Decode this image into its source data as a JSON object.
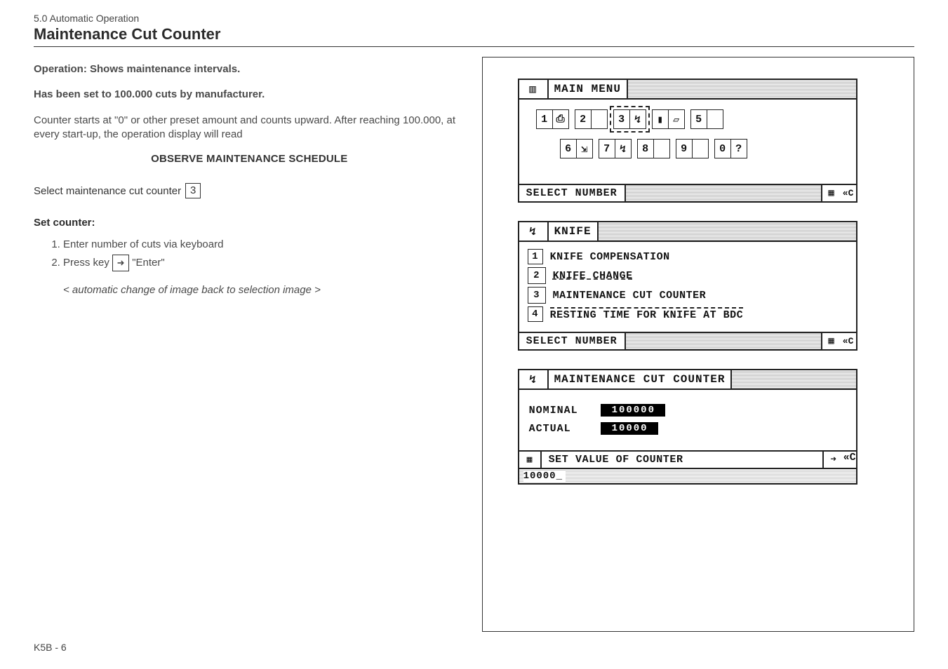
{
  "breadcrumb": "5.0 Automatic Operation",
  "title": "Maintenance Cut Counter",
  "left": {
    "op_label": "Operation:  Shows maintenance intervals.",
    "preset_line": "Has been set to 100.000 cuts by manufacturer.",
    "para1": "Counter starts at \"0\" or other preset amount and counts upward. After reaching 100.000, at every start-up, the operation display will read",
    "schedule": "OBSERVE MAINTENANCE SCHEDULE",
    "select_label": "Select maintenance cut counter",
    "select_key": "3",
    "set_counter_head": "Set counter:",
    "step1": "Enter number of cuts via keyboard",
    "step2a": "Press key ",
    "enter_glyph": "➜",
    "step2b": " \"Enter\"",
    "note": "< automatic change of image back to selection image >"
  },
  "lcd_main": {
    "icon": "▥",
    "title": "MAIN MENU",
    "row1": [
      {
        "n": "1",
        "sym": "⎙"
      },
      {
        "n": "2",
        "sym": " ",
        "blank": true
      },
      {
        "n": "3",
        "sym": "↯",
        "hl": true
      },
      {
        "n": "▮",
        "sym": "▱"
      },
      {
        "n": "5",
        "sym": " ",
        "blank": true
      }
    ],
    "row2": [
      {
        "n": "6",
        "sym": "⇲"
      },
      {
        "n": "7",
        "sym": "↯"
      },
      {
        "n": "8",
        "sym": " ",
        "blank": true
      },
      {
        "n": "9",
        "sym": " ",
        "blank": true
      },
      {
        "n": "0",
        "sym": "?"
      }
    ],
    "foot_label": "SELECT NUMBER",
    "foot_icon": "▦",
    "foot_c": "«C"
  },
  "lcd_knife": {
    "icon": "↯",
    "title": "KNIFE",
    "items": [
      {
        "n": "1",
        "label": "KNIFE COMPENSATION"
      },
      {
        "n": "2",
        "label": "KNIFE CHANGE",
        "dashed_after": true
      },
      {
        "n": "3",
        "label": "MAINTENANCE CUT COUNTER",
        "hl": true
      },
      {
        "n": "4",
        "label": "RESTING TIME FOR KNIFE AT BDC",
        "dashed_before": true
      }
    ],
    "foot_label": "SELECT NUMBER",
    "foot_icon": "▦",
    "foot_c": "«C"
  },
  "lcd_counter": {
    "icon": "↯",
    "title": "MAINTENANCE CUT COUNTER",
    "nominal_label": "NOMINAL",
    "nominal_value": "100000",
    "actual_label": "ACTUAL",
    "actual_value": "10000",
    "foot_grid": "▦",
    "foot_label": "SET VALUE OF COUNTER",
    "foot_enter": "➜",
    "foot_c": "«C",
    "input_value": "10000_"
  },
  "footer": "K5B - 6"
}
